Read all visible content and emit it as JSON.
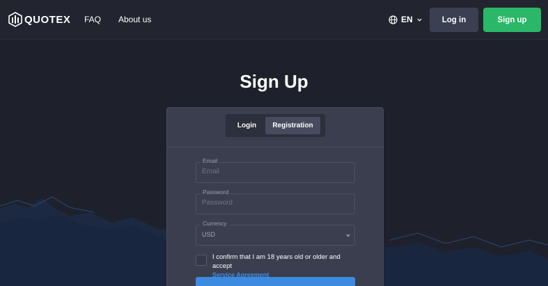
{
  "header": {
    "logo_text": "QUOTEX",
    "nav": {
      "faq": "FAQ",
      "about": "About us"
    },
    "language": "EN",
    "login_label": "Log in",
    "signup_label": "Sign up"
  },
  "page": {
    "title": "Sign Up"
  },
  "form": {
    "tabs": {
      "login": "Login",
      "registration": "Registration",
      "active": "Registration"
    },
    "email": {
      "label": "Email",
      "placeholder": "Email"
    },
    "password": {
      "label": "Password",
      "placeholder": "Password"
    },
    "currency": {
      "label": "Currency",
      "value": "USD"
    },
    "agreement": {
      "text": "I confirm that I am 18 years old or older and accept",
      "link": "Service Agreement",
      "checked": false
    }
  },
  "colors": {
    "background": "#1e212c",
    "header": "#22252f",
    "card": "#3a3e4e",
    "signup_green": "#2ab868",
    "login_gray": "#3a3f51",
    "link_blue": "#3c8ee6",
    "submit_blue": "#3c8be0"
  },
  "icons": [
    "quotex-logo-icon",
    "globe-icon",
    "chevron-down-icon",
    "caret-down-icon"
  ]
}
